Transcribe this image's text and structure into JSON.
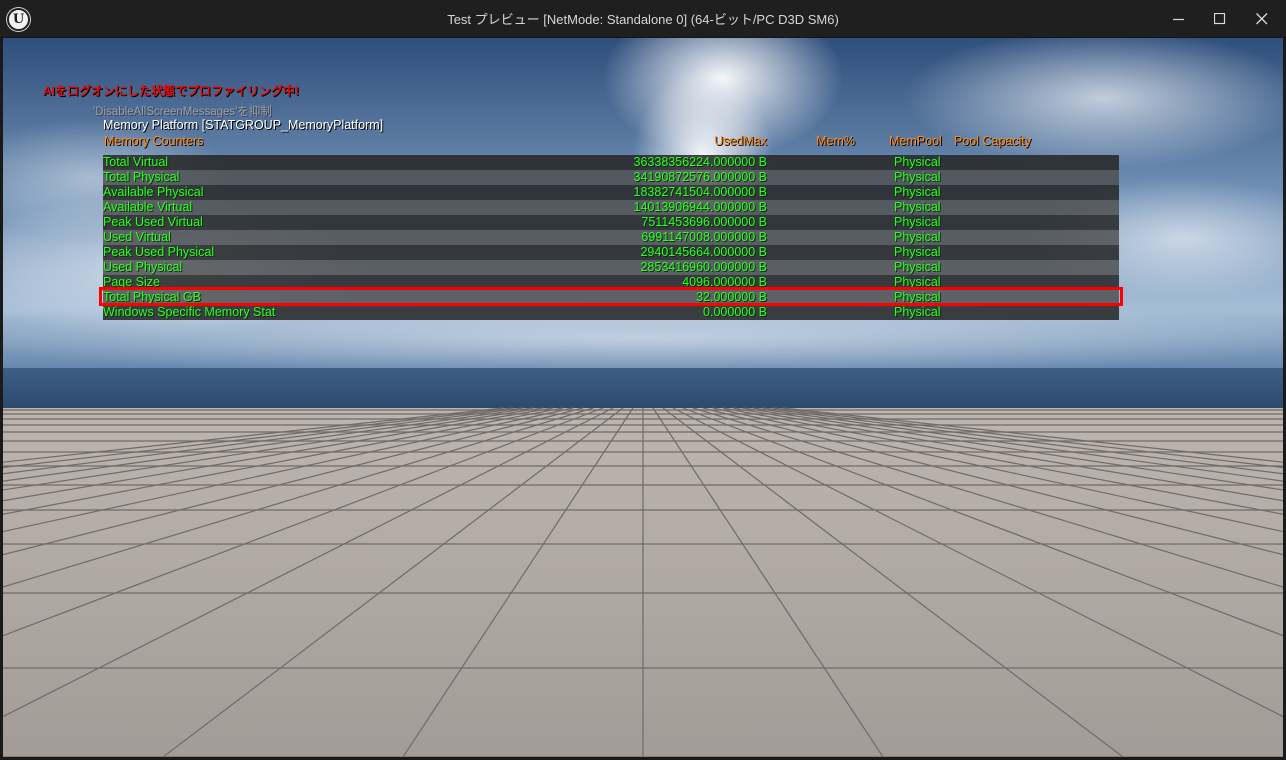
{
  "window": {
    "title": "Test プレビュー [NetMode: Standalone 0]  (64-ビット/PC D3D SM6)",
    "logo_text": "U"
  },
  "overlay": {
    "warning": "AIをログオンにした状態でプロファイリング中!",
    "suppressed": "'DisableAllScreenMessages'を抑制",
    "stat_title": "Memory Platform [STATGROUP_MemoryPlatform]",
    "headers": {
      "name": "Memory Counters",
      "used_max": "UsedMax",
      "mem_pct": "Mem%",
      "mem_pool": "MemPool",
      "pool_capacity": "Pool Capacity"
    },
    "rows": [
      {
        "name": "Total Virtual",
        "used": "36338356224.000000 B",
        "pool": "Physical"
      },
      {
        "name": "Total Physical",
        "used": "34190872576.000000 B",
        "pool": "Physical"
      },
      {
        "name": "Available Physical",
        "used": "18382741504.000000 B",
        "pool": "Physical"
      },
      {
        "name": "Available Virtual",
        "used": "14013906944.000000 B",
        "pool": "Physical"
      },
      {
        "name": "Peak Used Virtual",
        "used": "7511453696.000000 B",
        "pool": "Physical"
      },
      {
        "name": "Used Virtual",
        "used": "6991147008.000000 B",
        "pool": "Physical"
      },
      {
        "name": "Peak Used Physical",
        "used": "2940145664.000000 B",
        "pool": "Physical"
      },
      {
        "name": "Used Physical",
        "used": "2853416960.000000 B",
        "pool": "Physical"
      },
      {
        "name": "Page Size",
        "used": "4096.000000 B",
        "pool": "Physical"
      },
      {
        "name": "Total Physical GB",
        "used": "32.000000 B",
        "pool": "Physical"
      },
      {
        "name": "Windows Specific Memory Stat",
        "used": "0.000000 B",
        "pool": "Physical"
      }
    ]
  },
  "colors": {
    "counter_text": "#2cff22",
    "header_text": "#ff8a1e",
    "warning_text": "#e01010",
    "highlight_border": "#ff0000"
  },
  "icons": {
    "minimize": "minimize-icon",
    "maximize": "maximize-icon",
    "close": "close-icon"
  }
}
